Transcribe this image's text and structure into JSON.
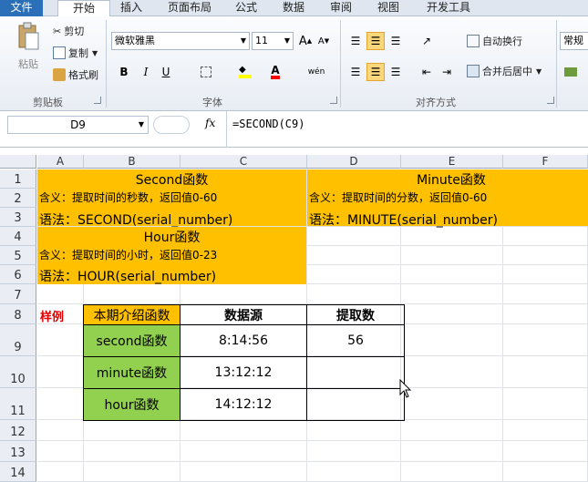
{
  "tabs": [
    "文件",
    "开始",
    "插入",
    "页面布局",
    "公式",
    "数据",
    "审阅",
    "视图",
    "开发工具"
  ],
  "clipboard": {
    "paste": "粘贴",
    "cut": "剪切",
    "copy": "复制",
    "format_painter": "格式刷",
    "group": "剪贴板"
  },
  "font": {
    "name": "微软雅黑",
    "size": "11",
    "bold": "B",
    "italic": "I",
    "underline": "U",
    "grow": "A",
    "shrink": "A",
    "font_color_letter": "A",
    "phonetic": "wén",
    "group": "字体"
  },
  "alignment": {
    "wrap": "自动换行",
    "merge": "合并后居中",
    "group": "对齐方式"
  },
  "number": {
    "format": "常规"
  },
  "formula_bar": {
    "cell_ref": "D9",
    "fx": "fx",
    "formula": "=SECOND(C9)"
  },
  "columns": [
    "A",
    "B",
    "C",
    "D",
    "E",
    "F"
  ],
  "rows": [
    "1",
    "2",
    "3",
    "4",
    "5",
    "6",
    "7",
    "8",
    "9",
    "10",
    "11",
    "12",
    "13",
    "14"
  ],
  "cards": {
    "second": {
      "title": "Second函数",
      "desc": "含义：提取时间的秒数，返回值0-60",
      "syntax": "语法：SECOND(serial_number)"
    },
    "minute": {
      "title": "Minute函数",
      "desc": "含义：提取时间的分数，返回值0-60",
      "syntax": "语法：MINUTE(serial_number)"
    },
    "hour": {
      "title": "Hour函数",
      "desc": "含义：提取时间的小时，返回值0-23",
      "syntax": "语法：HOUR(serial_number)"
    }
  },
  "sample_label": "样例",
  "table": {
    "headers": [
      "本期介绍函数",
      "数据源",
      "提取数"
    ],
    "rows": [
      {
        "func": "second函数",
        "source": "8:14:56",
        "result": "56"
      },
      {
        "func": "minute函数",
        "source": "13:12:12",
        "result": ""
      },
      {
        "func": "hour函数",
        "source": "14:12:12",
        "result": ""
      }
    ]
  },
  "colors": {
    "card": "#ffc000",
    "func_cell": "#92d050",
    "sample_label": "#e00000",
    "file_tab": "#2a6fb8"
  }
}
